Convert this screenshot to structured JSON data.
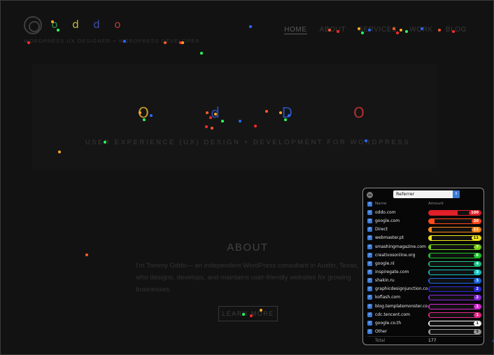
{
  "header": {
    "logo_icon": "target-logo-icon",
    "brand_letters": [
      "o",
      "d",
      "d",
      "o"
    ],
    "brand_colors": [
      "#3a8a4a",
      "#c8b93a",
      "#3a4fa8",
      "#b83a3a"
    ],
    "tagline": "WORDPRESS UX DESIGNER + WORDPRESS DEVELOPER",
    "nav": [
      {
        "label": "HOME",
        "active": true
      },
      {
        "label": "ABOUT",
        "active": false
      },
      {
        "label": "SERVICES",
        "active": false
      },
      {
        "label": "WORK",
        "active": false
      },
      {
        "label": "BLOG",
        "active": false
      }
    ]
  },
  "hero": {
    "letters": [
      "O",
      "d",
      "D",
      "O"
    ],
    "letter_colors": [
      "#c89a2a",
      "#2a4fb8",
      "#2a4fb8",
      "#b83030"
    ],
    "subtitle": "USER EXPERIENCE (UX) DESIGN + DEVELOPMENT FOR WORDPRESS"
  },
  "about": {
    "title": "ABOUT",
    "text": "I'm Tommy Oddo— an independent WordPress consultant in Austin, Texas, who designs, develops, and maintains user-friendly websites for growing businesses.",
    "button_label": "LEARN MORE"
  },
  "referrer_panel": {
    "selected": "Referrer",
    "col_name": "Name",
    "col_amount": "Amount",
    "rows": [
      {
        "name": "oddo.com",
        "value": "100",
        "fill": 0.55,
        "color": "#e0202a"
      },
      {
        "name": "google.com",
        "value": "20",
        "fill": 0.11,
        "color": "#ff4a1a"
      },
      {
        "name": "Direct",
        "value": "11",
        "fill": 0.06,
        "color": "#ff8a1a"
      },
      {
        "name": "webmaster.pt",
        "value": "11",
        "fill": 0.06,
        "color": "#f2e81a"
      },
      {
        "name": "smashingmagazine.com",
        "value": "7",
        "fill": 0.04,
        "color": "#7ad21a"
      },
      {
        "name": "creativosonline.org",
        "value": "6",
        "fill": 0.03,
        "color": "#1ac82a"
      },
      {
        "name": "google.nl",
        "value": "4",
        "fill": 0.02,
        "color": "#1ac88a"
      },
      {
        "name": "inspiregate.com",
        "value": "3",
        "fill": 0.02,
        "color": "#1ac8c8"
      },
      {
        "name": "shakin.ru",
        "value": "3",
        "fill": 0.02,
        "color": "#1a6ae8"
      },
      {
        "name": "graphicdesignjunction.co",
        "value": "2",
        "fill": 0.01,
        "color": "#2a2ae0"
      },
      {
        "name": "koflash.com",
        "value": "2",
        "fill": 0.01,
        "color": "#8a2ae0"
      },
      {
        "name": "blog.templatemonster.co",
        "value": "1",
        "fill": 0.01,
        "color": "#d82ad8"
      },
      {
        "name": "cdc.tencent.com",
        "value": "1",
        "fill": 0.01,
        "color": "#e82a8a"
      },
      {
        "name": "google.co.th",
        "value": "1",
        "fill": 0.01,
        "color": "#ffffff"
      },
      {
        "name": "Other",
        "value": "5",
        "fill": 0.03,
        "color": "#9a9a9a"
      }
    ],
    "total_label": "Total",
    "total_value": "177"
  },
  "heatmap_dot_colors": [
    "#ff2a2a",
    "#ffaa2a",
    "#2aff5a",
    "#2a6aff",
    "#ff5a2a"
  ]
}
